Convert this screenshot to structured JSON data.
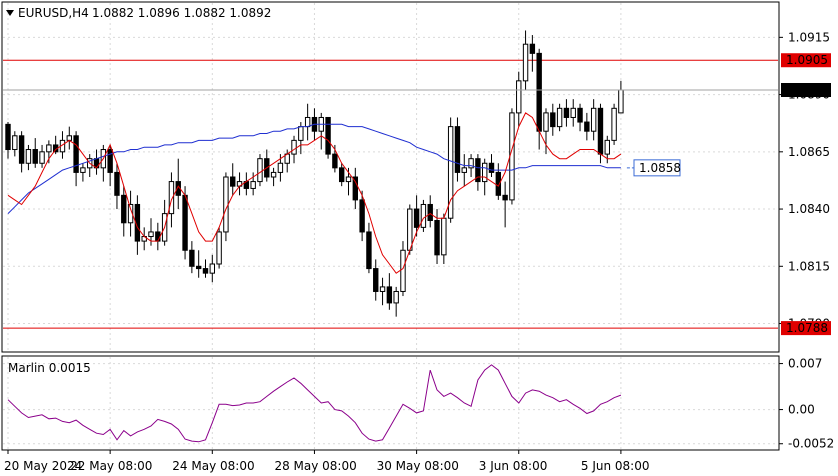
{
  "header": {
    "symbol_timeframe": "EURUSD,H4",
    "ohlc": "1.0882 1.0896 1.0882 1.0892"
  },
  "colors": {
    "bg": "#ffffff",
    "border": "#000000",
    "grid": "#d9d9d9",
    "bull": "#ffffff",
    "bear": "#000000",
    "ma_fast": "#e00000",
    "ma_slow": "#1f2fd1",
    "hline": "#e00000",
    "marlin": "#8b008b",
    "price_tag": "#000000",
    "ma_tag": "#3b6bd6"
  },
  "chart_data": [
    {
      "type": "candlestick",
      "panel": "main",
      "ylim": [
        1.0778,
        1.093
      ],
      "y_ticks": [
        "1.0915",
        "1.0890",
        "1.0865",
        "1.0840",
        "1.0815",
        "1.0790"
      ],
      "y_tick_values": [
        1.0915,
        1.089,
        1.0865,
        1.084,
        1.0815,
        1.079
      ],
      "x_labels": [
        "20 May 2024",
        "22 May 08:00",
        "24 May 08:00",
        "28 May 08:00",
        "30 May 08:00",
        "3 Jun 08:00",
        "5 Jun 08:00"
      ],
      "x_label_index": [
        0,
        15,
        30,
        45,
        60,
        75,
        90
      ],
      "candles": [
        [
          1.0877,
          1.0878,
          1.0862,
          1.0866
        ],
        [
          1.0866,
          1.0874,
          1.0863,
          1.0872
        ],
        [
          1.0872,
          1.0874,
          1.0856,
          1.086
        ],
        [
          1.086,
          1.0868,
          1.0857,
          1.0866
        ],
        [
          1.0866,
          1.0871,
          1.0858,
          1.086
        ],
        [
          1.086,
          1.0868,
          1.0858,
          1.0865
        ],
        [
          1.0865,
          1.087,
          1.086,
          1.0868
        ],
        [
          1.0868,
          1.0872,
          1.0864,
          1.0865
        ],
        [
          1.0865,
          1.0874,
          1.0862,
          1.087
        ],
        [
          1.087,
          1.0876,
          1.0866,
          1.0872
        ],
        [
          1.0872,
          1.0874,
          1.085,
          1.0856
        ],
        [
          1.0856,
          1.086,
          1.0852,
          1.0858
        ],
        [
          1.0858,
          1.0864,
          1.0854,
          1.0862
        ],
        [
          1.0862,
          1.0866,
          1.0855,
          1.0858
        ],
        [
          1.0858,
          1.0868,
          1.0852,
          1.0866
        ],
        [
          1.0866,
          1.0868,
          1.085,
          1.0856
        ],
        [
          1.0856,
          1.086,
          1.084,
          1.0846
        ],
        [
          1.0846,
          1.085,
          1.0828,
          1.0834
        ],
        [
          1.0834,
          1.0848,
          1.0828,
          1.0842
        ],
        [
          1.0842,
          1.0846,
          1.082,
          1.0826
        ],
        [
          1.0826,
          1.0832,
          1.0822,
          1.0828
        ],
        [
          1.0828,
          1.0836,
          1.0824,
          1.083
        ],
        [
          1.083,
          1.0834,
          1.0822,
          1.0826
        ],
        [
          1.0826,
          1.0844,
          1.0824,
          1.0838
        ],
        [
          1.0838,
          1.0856,
          1.0832,
          1.0852
        ],
        [
          1.0852,
          1.0862,
          1.084,
          1.0846
        ],
        [
          1.0846,
          1.085,
          1.0818,
          1.0822
        ],
        [
          1.0822,
          1.0826,
          1.0812,
          1.0815
        ],
        [
          1.0815,
          1.0822,
          1.081,
          1.0814
        ],
        [
          1.0814,
          1.0818,
          1.081,
          1.0812
        ],
        [
          1.0812,
          1.082,
          1.0808,
          1.0816
        ],
        [
          1.0816,
          1.0832,
          1.0814,
          1.083
        ],
        [
          1.083,
          1.0856,
          1.0826,
          1.0854
        ],
        [
          1.0854,
          1.086,
          1.0846,
          1.085
        ],
        [
          1.085,
          1.0856,
          1.0846,
          1.0852
        ],
        [
          1.0852,
          1.0856,
          1.0846,
          1.0849
        ],
        [
          1.0849,
          1.0856,
          1.0846,
          1.0852
        ],
        [
          1.0852,
          1.0864,
          1.085,
          1.0862
        ],
        [
          1.0862,
          1.0866,
          1.0852,
          1.0854
        ],
        [
          1.0854,
          1.0858,
          1.085,
          1.0856
        ],
        [
          1.0856,
          1.0864,
          1.0852,
          1.086
        ],
        [
          1.086,
          1.0866,
          1.0856,
          1.0864
        ],
        [
          1.0864,
          1.0872,
          1.086,
          1.087
        ],
        [
          1.087,
          1.0878,
          1.0864,
          1.0876
        ],
        [
          1.0876,
          1.0886,
          1.087,
          1.088
        ],
        [
          1.088,
          1.0884,
          1.087,
          1.0874
        ],
        [
          1.0874,
          1.0882,
          1.0866,
          1.088
        ],
        [
          1.088,
          1.088,
          1.0862,
          1.0864
        ],
        [
          1.0864,
          1.0868,
          1.0856,
          1.0858
        ],
        [
          1.0858,
          1.086,
          1.085,
          1.0852
        ],
        [
          1.0852,
          1.0858,
          1.0846,
          1.0854
        ],
        [
          1.0854,
          1.0858,
          1.084,
          1.0844
        ],
        [
          1.0844,
          1.0848,
          1.0826,
          1.083
        ],
        [
          1.083,
          1.0834,
          1.0812,
          1.0814
        ],
        [
          1.0814,
          1.0818,
          1.08,
          1.0804
        ],
        [
          1.0804,
          1.081,
          1.0798,
          1.0806
        ],
        [
          1.0806,
          1.0812,
          1.0796,
          1.0799
        ],
        [
          1.0799,
          1.0806,
          1.0793,
          1.0804
        ],
        [
          1.0804,
          1.0826,
          1.0802,
          1.0822
        ],
        [
          1.0822,
          1.0842,
          1.082,
          1.084
        ],
        [
          1.084,
          1.0846,
          1.0828,
          1.0832
        ],
        [
          1.0832,
          1.0844,
          1.083,
          1.0842
        ],
        [
          1.0842,
          1.0846,
          1.0832,
          1.0835
        ],
        [
          1.0835,
          1.084,
          1.0816,
          1.082
        ],
        [
          1.082,
          1.0838,
          1.0816,
          1.0836
        ],
        [
          1.0836,
          1.088,
          1.0834,
          1.0876
        ],
        [
          1.0876,
          1.088,
          1.0852,
          1.0856
        ],
        [
          1.0856,
          1.0864,
          1.085,
          1.0858
        ],
        [
          1.0858,
          1.0864,
          1.0854,
          1.0862
        ],
        [
          1.0862,
          1.0864,
          1.0848,
          1.0852
        ],
        [
          1.0852,
          1.0862,
          1.0846,
          1.086
        ],
        [
          1.086,
          1.0864,
          1.0854,
          1.0856
        ],
        [
          1.0856,
          1.086,
          1.0844,
          1.0846
        ],
        [
          1.0846,
          1.0852,
          1.0832,
          1.0844
        ],
        [
          1.0844,
          1.0884,
          1.0842,
          1.0882
        ],
        [
          1.0882,
          1.09,
          1.0876,
          1.0896
        ],
        [
          1.0896,
          1.0918,
          1.0892,
          1.0912
        ],
        [
          1.0912,
          1.0916,
          1.09,
          1.0908
        ],
        [
          1.0908,
          1.091,
          1.0866,
          1.0874
        ],
        [
          1.0874,
          1.0884,
          1.0864,
          1.0882
        ],
        [
          1.0882,
          1.0886,
          1.0872,
          1.0876
        ],
        [
          1.0876,
          1.0886,
          1.0874,
          1.0884
        ],
        [
          1.0884,
          1.0888,
          1.0876,
          1.088
        ],
        [
          1.088,
          1.0888,
          1.0876,
          1.0884
        ],
        [
          1.0884,
          1.0886,
          1.0874,
          1.0878
        ],
        [
          1.0878,
          1.0882,
          1.087,
          1.0874
        ],
        [
          1.0874,
          1.0888,
          1.087,
          1.0884
        ],
        [
          1.0884,
          1.0886,
          1.086,
          1.0864
        ],
        [
          1.0864,
          1.0872,
          1.086,
          1.087
        ],
        [
          1.087,
          1.0886,
          1.0868,
          1.0884
        ],
        [
          1.0882,
          1.0896,
          1.0882,
          1.0892
        ]
      ],
      "ma_fast": [
        1.0846,
        1.0844,
        1.0842,
        1.0846,
        1.085,
        1.0856,
        1.0862,
        1.0866,
        1.0868,
        1.087,
        1.0868,
        1.0864,
        1.086,
        1.0858,
        1.0862,
        1.0868,
        1.086,
        1.085,
        1.084,
        1.0832,
        1.0828,
        1.0826,
        1.0826,
        1.0832,
        1.0844,
        1.085,
        1.0846,
        1.0838,
        1.083,
        1.0826,
        1.0826,
        1.0832,
        1.084,
        1.0846,
        1.085,
        1.0852,
        1.0854,
        1.0856,
        1.0858,
        1.086,
        1.0862,
        1.0864,
        1.0866,
        1.0868,
        1.0868,
        1.087,
        1.0872,
        1.087,
        1.0866,
        1.086,
        1.0856,
        1.0852,
        1.0846,
        1.0838,
        1.0828,
        1.082,
        1.0816,
        1.0812,
        1.0814,
        1.0822,
        1.083,
        1.0836,
        1.0838,
        1.0836,
        1.0836,
        1.0844,
        1.0848,
        1.085,
        1.0852,
        1.0854,
        1.0854,
        1.0852,
        1.085,
        1.0856,
        1.0866,
        1.0876,
        1.0882,
        1.088,
        1.0874,
        1.0868,
        1.0864,
        1.0862,
        1.0862,
        1.0864,
        1.0866,
        1.0866,
        1.0866,
        1.0864,
        1.0862,
        1.0862,
        1.0864
      ],
      "ma_slow": [
        1.0838,
        1.0841,
        1.0844,
        1.0847,
        1.0849,
        1.0851,
        1.0853,
        1.0855,
        1.0857,
        1.0858,
        1.0859,
        1.086,
        1.0861,
        1.0862,
        1.0863,
        1.0864,
        1.0865,
        1.0865,
        1.0866,
        1.0866,
        1.0867,
        1.0867,
        1.0867,
        1.0868,
        1.0868,
        1.0869,
        1.0869,
        1.0869,
        1.087,
        1.087,
        1.087,
        1.0871,
        1.0871,
        1.0871,
        1.0872,
        1.0872,
        1.0872,
        1.0873,
        1.0873,
        1.0874,
        1.0874,
        1.0875,
        1.0875,
        1.0876,
        1.0876,
        1.0877,
        1.0877,
        1.0877,
        1.0877,
        1.0877,
        1.0876,
        1.0876,
        1.0876,
        1.0875,
        1.0874,
        1.0873,
        1.0872,
        1.0871,
        1.087,
        1.0869,
        1.0867,
        1.0866,
        1.0865,
        1.0864,
        1.0862,
        1.0861,
        1.086,
        1.0859,
        1.0859,
        1.0858,
        1.0858,
        1.0857,
        1.0857,
        1.0857,
        1.0857,
        1.0858,
        1.0858,
        1.0859,
        1.0859,
        1.0859,
        1.0859,
        1.0859,
        1.0859,
        1.0859,
        1.0859,
        1.0859,
        1.0859,
        1.0859,
        1.0858,
        1.0858,
        1.0858
      ],
      "hlines": [
        {
          "label": "1.0905",
          "value": 1.0905
        },
        {
          "label": "1.0788",
          "value": 1.0788
        }
      ],
      "price_tag": {
        "label": "1.0892",
        "value": 1.0892
      },
      "ma_tag": {
        "label": "1.0858",
        "value": 1.0858
      }
    },
    {
      "type": "line",
      "panel": "indicator",
      "name": "Marlin 0.0015",
      "ylim": [
        -0.006,
        0.008
      ],
      "y_ticks": [
        "0.007",
        "0.00",
        "-0.0052"
      ],
      "y_tick_values": [
        0.007,
        0.0,
        -0.0052
      ],
      "values": [
        0.0015,
        0.0005,
        -0.0005,
        -0.0012,
        -0.001,
        -0.0008,
        -0.0014,
        -0.0013,
        -0.0018,
        -0.002,
        -0.0016,
        -0.0024,
        -0.003,
        -0.0036,
        -0.0038,
        -0.003,
        -0.0046,
        -0.0032,
        -0.004,
        -0.0034,
        -0.003,
        -0.0025,
        -0.0015,
        -0.0018,
        -0.0022,
        -0.003,
        -0.0045,
        -0.0048,
        -0.0049,
        -0.0046,
        -0.002,
        0.0008,
        0.0008,
        0.0006,
        0.0007,
        0.001,
        0.001,
        0.0012,
        0.002,
        0.0028,
        0.0035,
        0.0042,
        0.0048,
        0.004,
        0.003,
        0.002,
        0.001,
        0.0012,
        0.0,
        -0.0002,
        -0.001,
        -0.002,
        -0.0036,
        -0.0045,
        -0.0048,
        -0.0046,
        -0.0028,
        -0.001,
        0.0008,
        0.0002,
        -0.0005,
        -0.0002,
        0.006,
        0.003,
        0.002,
        0.0025,
        0.0018,
        0.001,
        0.0005,
        0.0045,
        0.006,
        0.0068,
        0.006,
        0.004,
        0.002,
        0.001,
        0.0025,
        0.003,
        0.0028,
        0.0022,
        0.0018,
        0.0012,
        0.0015,
        0.0008,
        0.0002,
        -0.0006,
        -0.0002,
        0.0008,
        0.0012,
        0.0018,
        0.0022
      ]
    }
  ]
}
